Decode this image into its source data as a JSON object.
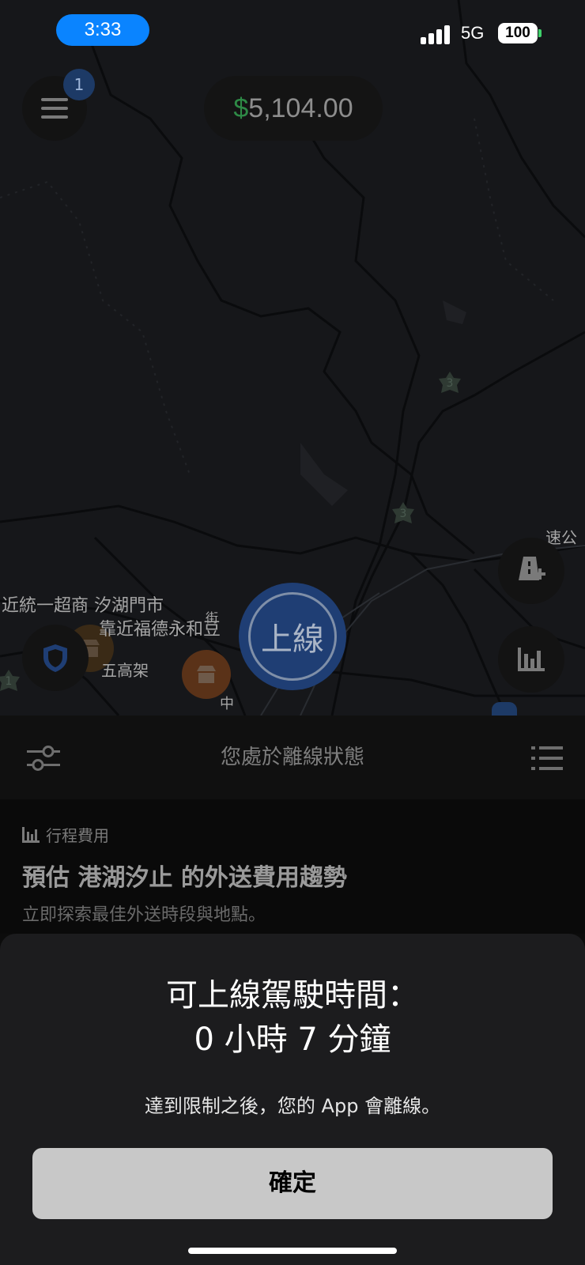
{
  "status_bar": {
    "time": "3:33",
    "network": "5G",
    "battery": "100"
  },
  "header": {
    "menu_badge": "1",
    "earnings_symbol": "$",
    "earnings_amount": "5,104.00"
  },
  "map": {
    "labels": [
      "近統一超商 汐湖門市",
      "靠近福德永和豆",
      "五高架",
      "街",
      "中",
      "速公"
    ],
    "highway_markers": [
      "3",
      "3",
      "1"
    ],
    "go_button_label": "上線"
  },
  "panel": {
    "status_title": "您處於離線狀態"
  },
  "trip_card": {
    "tag": "行程費用",
    "title": "預估 港湖汐止 的外送費用趨勢",
    "subtitle": "立即探索最佳外送時段與地點。"
  },
  "sheet": {
    "title_line1": "可上線駕駛時間：",
    "title_line2": "0 小時 7 分鐘",
    "message": "達到限制之後，您的 App 會離線。",
    "confirm_label": "確定"
  },
  "colors": {
    "accent": "#0a84ff",
    "go_button": "#1f3e74",
    "earnings_dollar": "#2e8a46"
  }
}
